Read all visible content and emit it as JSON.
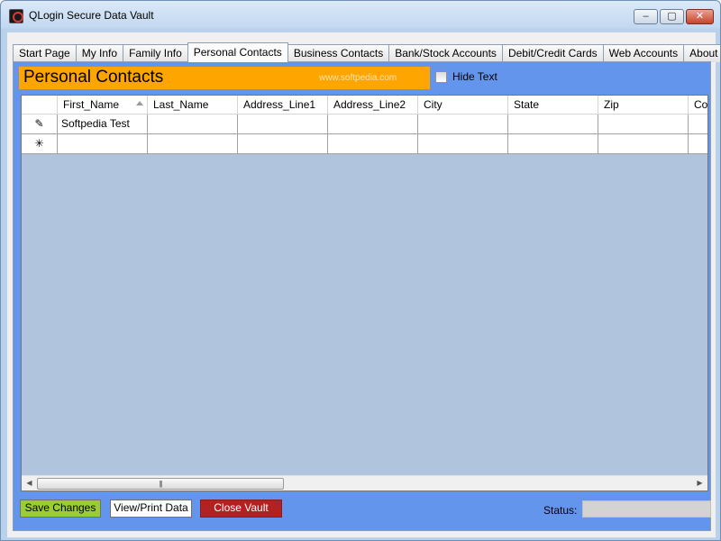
{
  "window": {
    "title": "QLogin Secure Data Vault",
    "controls": {
      "minimize": "–",
      "maximize": "▢",
      "close": "✕"
    }
  },
  "tabs": [
    {
      "label": "Start Page",
      "active": false
    },
    {
      "label": "My Info",
      "active": false
    },
    {
      "label": "Family Info",
      "active": false
    },
    {
      "label": "Personal Contacts",
      "active": true
    },
    {
      "label": "Business Contacts",
      "active": false
    },
    {
      "label": "Bank/Stock Accounts",
      "active": false
    },
    {
      "label": "Debit/Credit Cards",
      "active": false
    },
    {
      "label": "Web Accounts",
      "active": false
    },
    {
      "label": "About QLogin",
      "active": false
    }
  ],
  "panel": {
    "title": "Personal Contacts",
    "watermark": "www.softpedia.com",
    "hide_text_label": "Hide Text",
    "hide_text_checked": false
  },
  "grid": {
    "columns": [
      "First_Name",
      "Last_Name",
      "Address_Line1",
      "Address_Line2",
      "City",
      "State",
      "Zip",
      "Co"
    ],
    "sorted_column": "First_Name",
    "rows": [
      {
        "marker": "✎",
        "cells": [
          "Softpedia Test",
          "",
          "",
          "",
          "",
          "",
          "",
          ""
        ]
      },
      {
        "marker": "✳",
        "cells": [
          "",
          "",
          "",
          "",
          "",
          "",
          "",
          ""
        ]
      }
    ],
    "scrollbar": {
      "left_arrow": "◀",
      "right_arrow": "▶",
      "thumb_grip": "|||"
    }
  },
  "buttons": {
    "save": "Save Changes",
    "view_print": "View/Print Data",
    "close_vault": "Close Vault"
  },
  "status": {
    "label": "Status:",
    "value": ""
  },
  "colors": {
    "panel_bg": "#6495ed",
    "header_bg": "#ffa500",
    "grid_bg": "#b0c4de",
    "save_bg": "#9acd32",
    "close_bg": "#b22222",
    "status_bg": "#d3d3d3"
  }
}
